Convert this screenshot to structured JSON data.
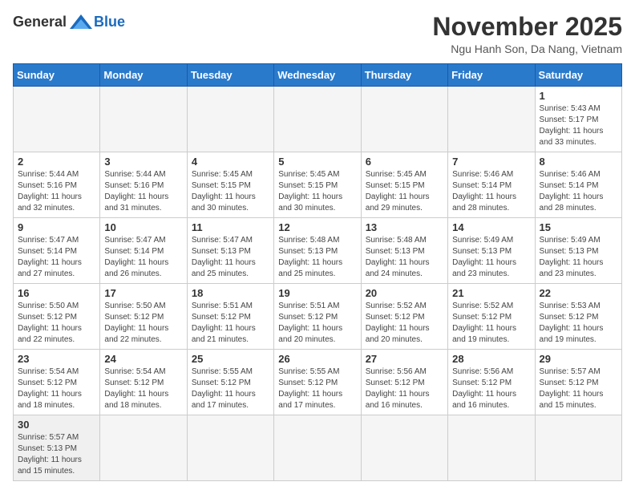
{
  "header": {
    "logo_general": "General",
    "logo_blue": "Blue",
    "month_title": "November 2025",
    "location": "Ngu Hanh Son, Da Nang, Vietnam"
  },
  "days_of_week": [
    "Sunday",
    "Monday",
    "Tuesday",
    "Wednesday",
    "Thursday",
    "Friday",
    "Saturday"
  ],
  "weeks": [
    [
      null,
      null,
      null,
      null,
      null,
      null,
      {
        "day": 1,
        "sunrise": "Sunrise: 5:43 AM",
        "sunset": "Sunset: 5:17 PM",
        "daylight": "Daylight: 11 hours and 33 minutes."
      }
    ],
    [
      {
        "day": 2,
        "sunrise": "Sunrise: 5:44 AM",
        "sunset": "Sunset: 5:16 PM",
        "daylight": "Daylight: 11 hours and 32 minutes."
      },
      {
        "day": 3,
        "sunrise": "Sunrise: 5:44 AM",
        "sunset": "Sunset: 5:16 PM",
        "daylight": "Daylight: 11 hours and 31 minutes."
      },
      {
        "day": 4,
        "sunrise": "Sunrise: 5:45 AM",
        "sunset": "Sunset: 5:15 PM",
        "daylight": "Daylight: 11 hours and 30 minutes."
      },
      {
        "day": 5,
        "sunrise": "Sunrise: 5:45 AM",
        "sunset": "Sunset: 5:15 PM",
        "daylight": "Daylight: 11 hours and 30 minutes."
      },
      {
        "day": 6,
        "sunrise": "Sunrise: 5:45 AM",
        "sunset": "Sunset: 5:15 PM",
        "daylight": "Daylight: 11 hours and 29 minutes."
      },
      {
        "day": 7,
        "sunrise": "Sunrise: 5:46 AM",
        "sunset": "Sunset: 5:14 PM",
        "daylight": "Daylight: 11 hours and 28 minutes."
      },
      {
        "day": 8,
        "sunrise": "Sunrise: 5:46 AM",
        "sunset": "Sunset: 5:14 PM",
        "daylight": "Daylight: 11 hours and 28 minutes."
      }
    ],
    [
      {
        "day": 9,
        "sunrise": "Sunrise: 5:47 AM",
        "sunset": "Sunset: 5:14 PM",
        "daylight": "Daylight: 11 hours and 27 minutes."
      },
      {
        "day": 10,
        "sunrise": "Sunrise: 5:47 AM",
        "sunset": "Sunset: 5:14 PM",
        "daylight": "Daylight: 11 hours and 26 minutes."
      },
      {
        "day": 11,
        "sunrise": "Sunrise: 5:47 AM",
        "sunset": "Sunset: 5:13 PM",
        "daylight": "Daylight: 11 hours and 25 minutes."
      },
      {
        "day": 12,
        "sunrise": "Sunrise: 5:48 AM",
        "sunset": "Sunset: 5:13 PM",
        "daylight": "Daylight: 11 hours and 25 minutes."
      },
      {
        "day": 13,
        "sunrise": "Sunrise: 5:48 AM",
        "sunset": "Sunset: 5:13 PM",
        "daylight": "Daylight: 11 hours and 24 minutes."
      },
      {
        "day": 14,
        "sunrise": "Sunrise: 5:49 AM",
        "sunset": "Sunset: 5:13 PM",
        "daylight": "Daylight: 11 hours and 23 minutes."
      },
      {
        "day": 15,
        "sunrise": "Sunrise: 5:49 AM",
        "sunset": "Sunset: 5:13 PM",
        "daylight": "Daylight: 11 hours and 23 minutes."
      }
    ],
    [
      {
        "day": 16,
        "sunrise": "Sunrise: 5:50 AM",
        "sunset": "Sunset: 5:12 PM",
        "daylight": "Daylight: 11 hours and 22 minutes."
      },
      {
        "day": 17,
        "sunrise": "Sunrise: 5:50 AM",
        "sunset": "Sunset: 5:12 PM",
        "daylight": "Daylight: 11 hours and 22 minutes."
      },
      {
        "day": 18,
        "sunrise": "Sunrise: 5:51 AM",
        "sunset": "Sunset: 5:12 PM",
        "daylight": "Daylight: 11 hours and 21 minutes."
      },
      {
        "day": 19,
        "sunrise": "Sunrise: 5:51 AM",
        "sunset": "Sunset: 5:12 PM",
        "daylight": "Daylight: 11 hours and 20 minutes."
      },
      {
        "day": 20,
        "sunrise": "Sunrise: 5:52 AM",
        "sunset": "Sunset: 5:12 PM",
        "daylight": "Daylight: 11 hours and 20 minutes."
      },
      {
        "day": 21,
        "sunrise": "Sunrise: 5:52 AM",
        "sunset": "Sunset: 5:12 PM",
        "daylight": "Daylight: 11 hours and 19 minutes."
      },
      {
        "day": 22,
        "sunrise": "Sunrise: 5:53 AM",
        "sunset": "Sunset: 5:12 PM",
        "daylight": "Daylight: 11 hours and 19 minutes."
      }
    ],
    [
      {
        "day": 23,
        "sunrise": "Sunrise: 5:54 AM",
        "sunset": "Sunset: 5:12 PM",
        "daylight": "Daylight: 11 hours and 18 minutes."
      },
      {
        "day": 24,
        "sunrise": "Sunrise: 5:54 AM",
        "sunset": "Sunset: 5:12 PM",
        "daylight": "Daylight: 11 hours and 18 minutes."
      },
      {
        "day": 25,
        "sunrise": "Sunrise: 5:55 AM",
        "sunset": "Sunset: 5:12 PM",
        "daylight": "Daylight: 11 hours and 17 minutes."
      },
      {
        "day": 26,
        "sunrise": "Sunrise: 5:55 AM",
        "sunset": "Sunset: 5:12 PM",
        "daylight": "Daylight: 11 hours and 17 minutes."
      },
      {
        "day": 27,
        "sunrise": "Sunrise: 5:56 AM",
        "sunset": "Sunset: 5:12 PM",
        "daylight": "Daylight: 11 hours and 16 minutes."
      },
      {
        "day": 28,
        "sunrise": "Sunrise: 5:56 AM",
        "sunset": "Sunset: 5:12 PM",
        "daylight": "Daylight: 11 hours and 16 minutes."
      },
      {
        "day": 29,
        "sunrise": "Sunrise: 5:57 AM",
        "sunset": "Sunset: 5:12 PM",
        "daylight": "Daylight: 11 hours and 15 minutes."
      }
    ],
    [
      {
        "day": 30,
        "sunrise": "Sunrise: 5:57 AM",
        "sunset": "Sunset: 5:13 PM",
        "daylight": "Daylight: 11 hours and 15 minutes."
      },
      null,
      null,
      null,
      null,
      null,
      null
    ]
  ]
}
